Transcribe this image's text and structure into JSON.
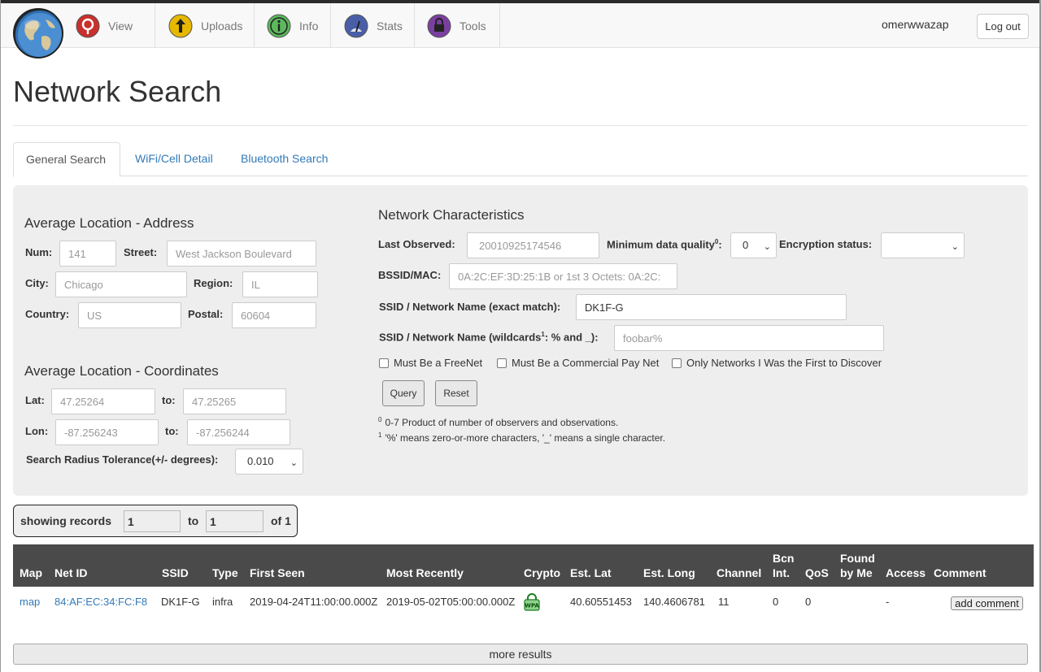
{
  "nav": {
    "items": [
      {
        "label": "View",
        "icon": "view-icon",
        "color": "#d9534f"
      },
      {
        "label": "Uploads",
        "icon": "upload-icon",
        "color": "#e0b400"
      },
      {
        "label": "Info",
        "icon": "info-icon",
        "color": "#5cb85c"
      },
      {
        "label": "Stats",
        "icon": "stats-icon",
        "color": "#4a5ea8"
      },
      {
        "label": "Tools",
        "icon": "tools-icon",
        "color": "#7a3fa0"
      }
    ],
    "username": "omerwwazap",
    "logout_label": "Log out"
  },
  "page_title": "Network Search",
  "tabs": [
    {
      "label": "General Search",
      "active": true
    },
    {
      "label": "WiFi/Cell Detail",
      "active": false
    },
    {
      "label": "Bluetooth Search",
      "active": false
    }
  ],
  "address": {
    "heading": "Average Location - Address",
    "num_label": "Num:",
    "num_placeholder": "141",
    "street_label": "Street:",
    "street_placeholder": "West Jackson Boulevard",
    "city_label": "City:",
    "city_placeholder": "Chicago",
    "region_label": "Region:",
    "region_placeholder": "IL",
    "country_label": "Country:",
    "country_placeholder": "US",
    "postal_label": "Postal:",
    "postal_placeholder": "60604"
  },
  "coordinates": {
    "heading": "Average Location - Coordinates",
    "lat_label": "Lat:",
    "lat_from_placeholder": "47.25264",
    "lat_to_label": "to:",
    "lat_to_placeholder": "47.25265",
    "lon_label": "Lon:",
    "lon_from_placeholder": "-87.256243",
    "lon_to_label": "to:",
    "lon_to_placeholder": "-87.256244",
    "radius_label": "Search Radius Tolerance(+/- degrees):",
    "radius_value": "0.010"
  },
  "network": {
    "heading": "Network Characteristics",
    "last_observed_label": "Last Observed:",
    "last_observed_placeholder": "20010925174546",
    "min_quality_label": "Minimum data quality",
    "min_quality_sup": "0",
    "min_quality_colon": ":",
    "min_quality_value": "0",
    "encryption_label": "Encryption status:",
    "encryption_value": "",
    "bssid_label": "BSSID/MAC:",
    "bssid_placeholder": "0A:2C:EF:3D:25:1B or 1st 3 Octets: 0A:2C:",
    "ssid_exact_label": "SSID / Network Name (exact match):",
    "ssid_exact_value": "DK1F-G",
    "ssid_wild_label": "SSID / Network Name (wildcards",
    "ssid_wild_sup": "1",
    "ssid_wild_label_end": ": % and _):",
    "ssid_wild_placeholder": "foobar%",
    "chk_freenet": "Must Be a FreeNet",
    "chk_paynet": "Must Be a Commercial Pay Net",
    "chk_first": "Only Networks I Was the First to Discover",
    "query_label": "Query",
    "reset_label": "Reset",
    "note0_sup": "0",
    "note0": "0-7 Product of number of observers and observations.",
    "note1_sup": "1",
    "note1": "'%' means zero-or-more characters, '_' means a single character."
  },
  "records": {
    "showing_label": "showing records",
    "from": "1",
    "to_label": "to",
    "to": "1",
    "of_label": "of 1"
  },
  "table": {
    "headers": {
      "map": "Map",
      "netid": "Net ID",
      "ssid": "SSID",
      "type": "Type",
      "first_seen": "First Seen",
      "most_recently": "Most Recently",
      "crypto": "Crypto",
      "est_lat": "Est. Lat",
      "est_long": "Est. Long",
      "channel": "Channel",
      "bcn_1": "Bcn",
      "bcn_2": "Int.",
      "qos": "QoS",
      "found_1": "Found",
      "found_2": "by Me",
      "access": "Access",
      "comment": "Comment"
    },
    "row": {
      "map": "map",
      "netid": "84:AF:EC:34:FC:F8",
      "ssid": "DK1F-G",
      "type": "infra",
      "first_seen": "2019-04-24T11:00:00.000Z",
      "most_recently": "2019-05-02T05:00:00.000Z",
      "crypto_icon": "wpa-lock-icon",
      "est_lat": "40.60551453",
      "est_long": "140.4606781",
      "channel": "11",
      "bcn_int": "0",
      "qos": "0",
      "found_by_me": "",
      "access": "-",
      "add_comment_label": "add comment"
    }
  },
  "more_results_label": "more results"
}
